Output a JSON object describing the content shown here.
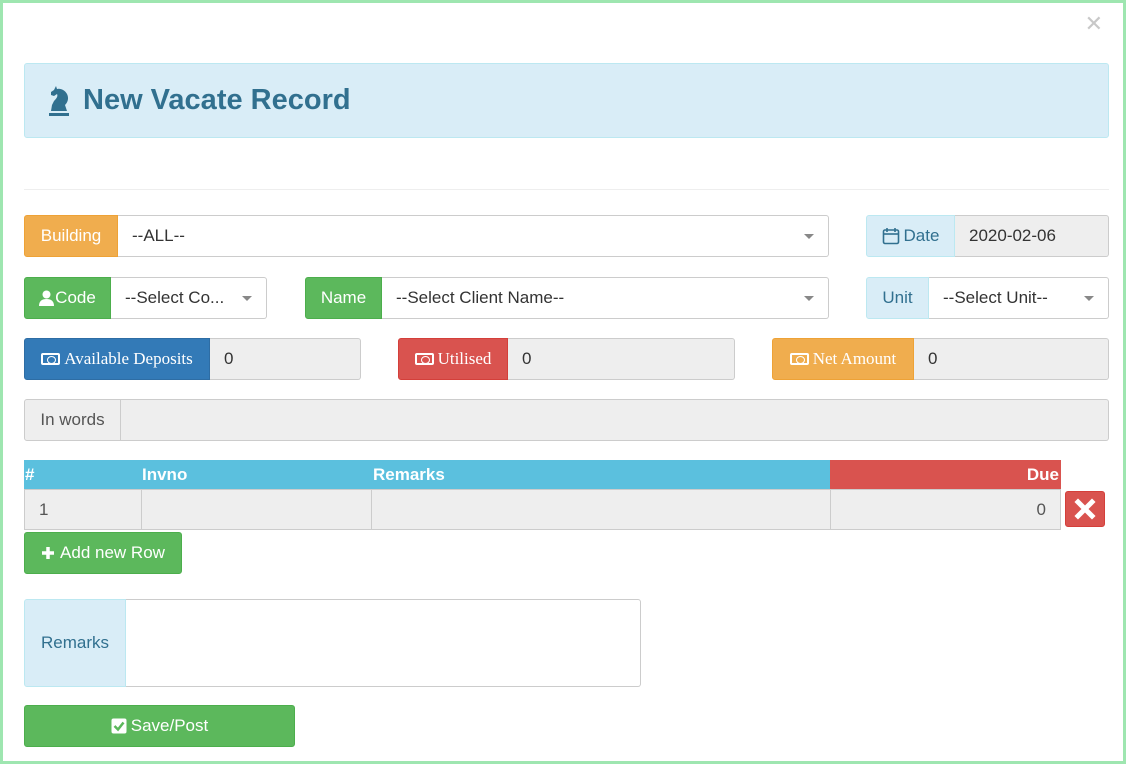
{
  "title": "New Vacate Record",
  "building": {
    "label": "Building",
    "value": "--ALL--"
  },
  "date": {
    "label": "Date",
    "value": "2020-02-06"
  },
  "code": {
    "label": "Code",
    "value": "--Select Co..."
  },
  "name": {
    "label": "Name",
    "value": "--Select Client Name--"
  },
  "unit": {
    "label": "Unit",
    "value": "--Select Unit--"
  },
  "available_deposits": {
    "label": "Available Deposits",
    "value": "0"
  },
  "utilised": {
    "label": "Utilised",
    "value": "0"
  },
  "net_amount": {
    "label": "Net Amount",
    "value": "0"
  },
  "in_words": {
    "label": "In words",
    "value": ""
  },
  "table": {
    "headers": {
      "num": "#",
      "invno": "Invno",
      "remarks": "Remarks",
      "due": "Due"
    },
    "rows": [
      {
        "num": "1",
        "invno": "",
        "remarks": "",
        "due": "0"
      }
    ]
  },
  "add_row_label": "Add new Row",
  "remarks": {
    "label": "Remarks",
    "value": ""
  },
  "save_label": "Save/Post",
  "colors": {
    "info": "#5bc0de",
    "danger": "#d9534f",
    "success": "#5cb85c",
    "warning": "#f0ad4e",
    "primary": "#337ab7"
  }
}
